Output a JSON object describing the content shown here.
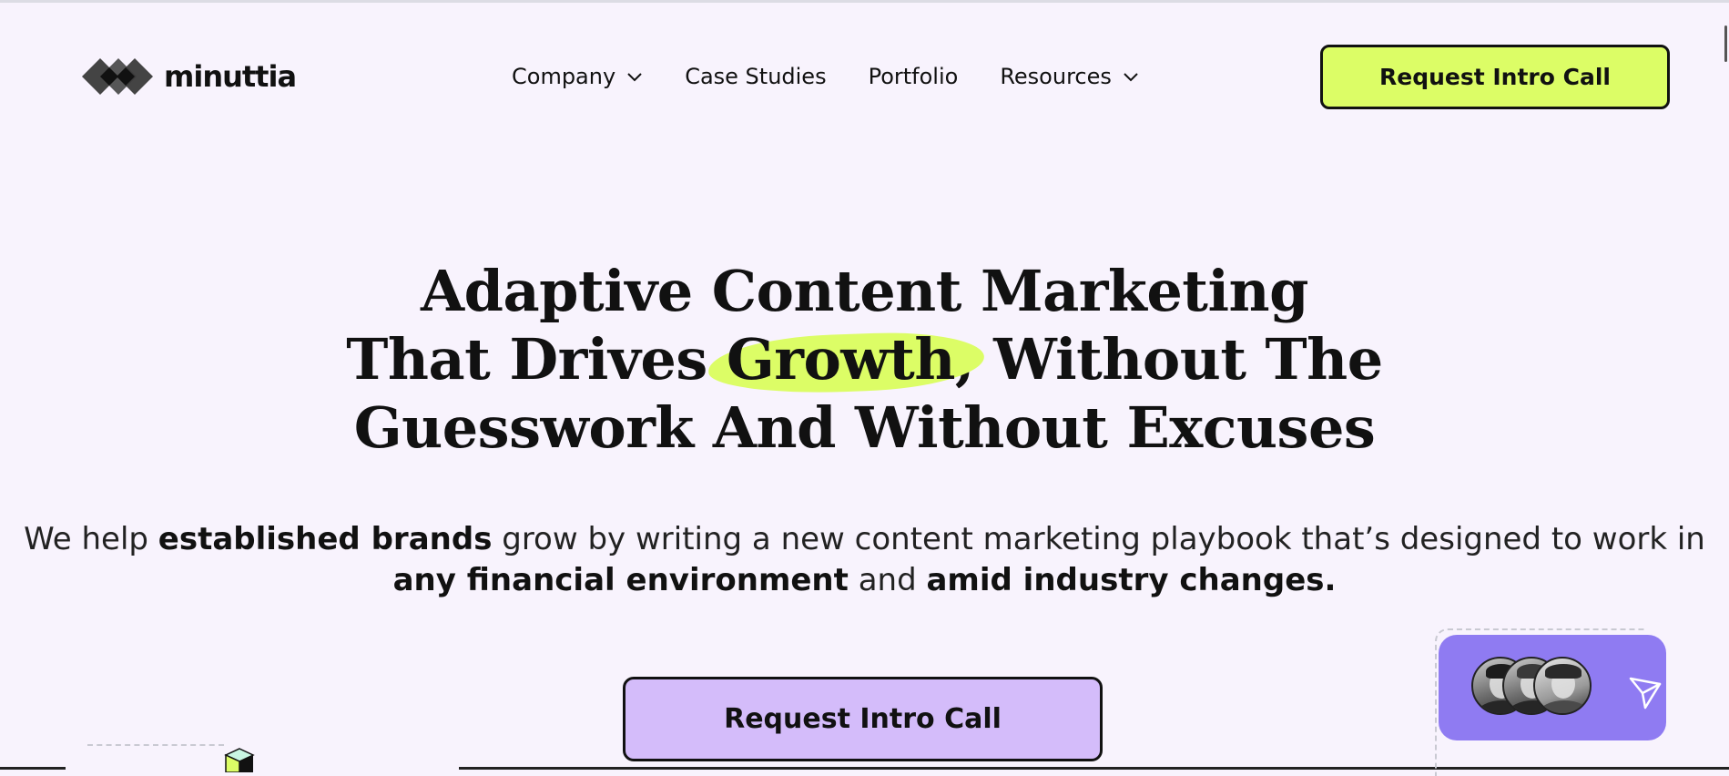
{
  "brand": {
    "name": "minuttia"
  },
  "nav": {
    "items": [
      {
        "label": "Company",
        "has_dropdown": true
      },
      {
        "label": "Case Studies",
        "has_dropdown": false
      },
      {
        "label": "Portfolio",
        "has_dropdown": false
      },
      {
        "label": "Resources",
        "has_dropdown": true
      }
    ]
  },
  "header": {
    "cta_label": "Request Intro Call"
  },
  "hero": {
    "title_line1": "Adaptive Content Marketing",
    "title_line2_pre": "That Drives ",
    "title_highlight": "Growth",
    "title_line2_post": ", Without The",
    "title_line3": "Guesswork And Without Excuses",
    "subtitle": {
      "p1": "We help ",
      "b1": "established brands",
      "p2": " grow by writing a new content marketing playbook that’s designed to work in ",
      "b2": "any financial environment",
      "p3": " and ",
      "b3": "amid industry changes."
    },
    "cta_label": "Request Intro Call"
  },
  "chat_widget": {
    "avatar_count": 3,
    "icon": "send-icon"
  },
  "colors": {
    "background": "#f8f3fd",
    "accent_lime": "#dcfd66",
    "accent_lavender": "#d4bcfa",
    "widget_purple": "#8f7bf2",
    "text": "#111111"
  }
}
